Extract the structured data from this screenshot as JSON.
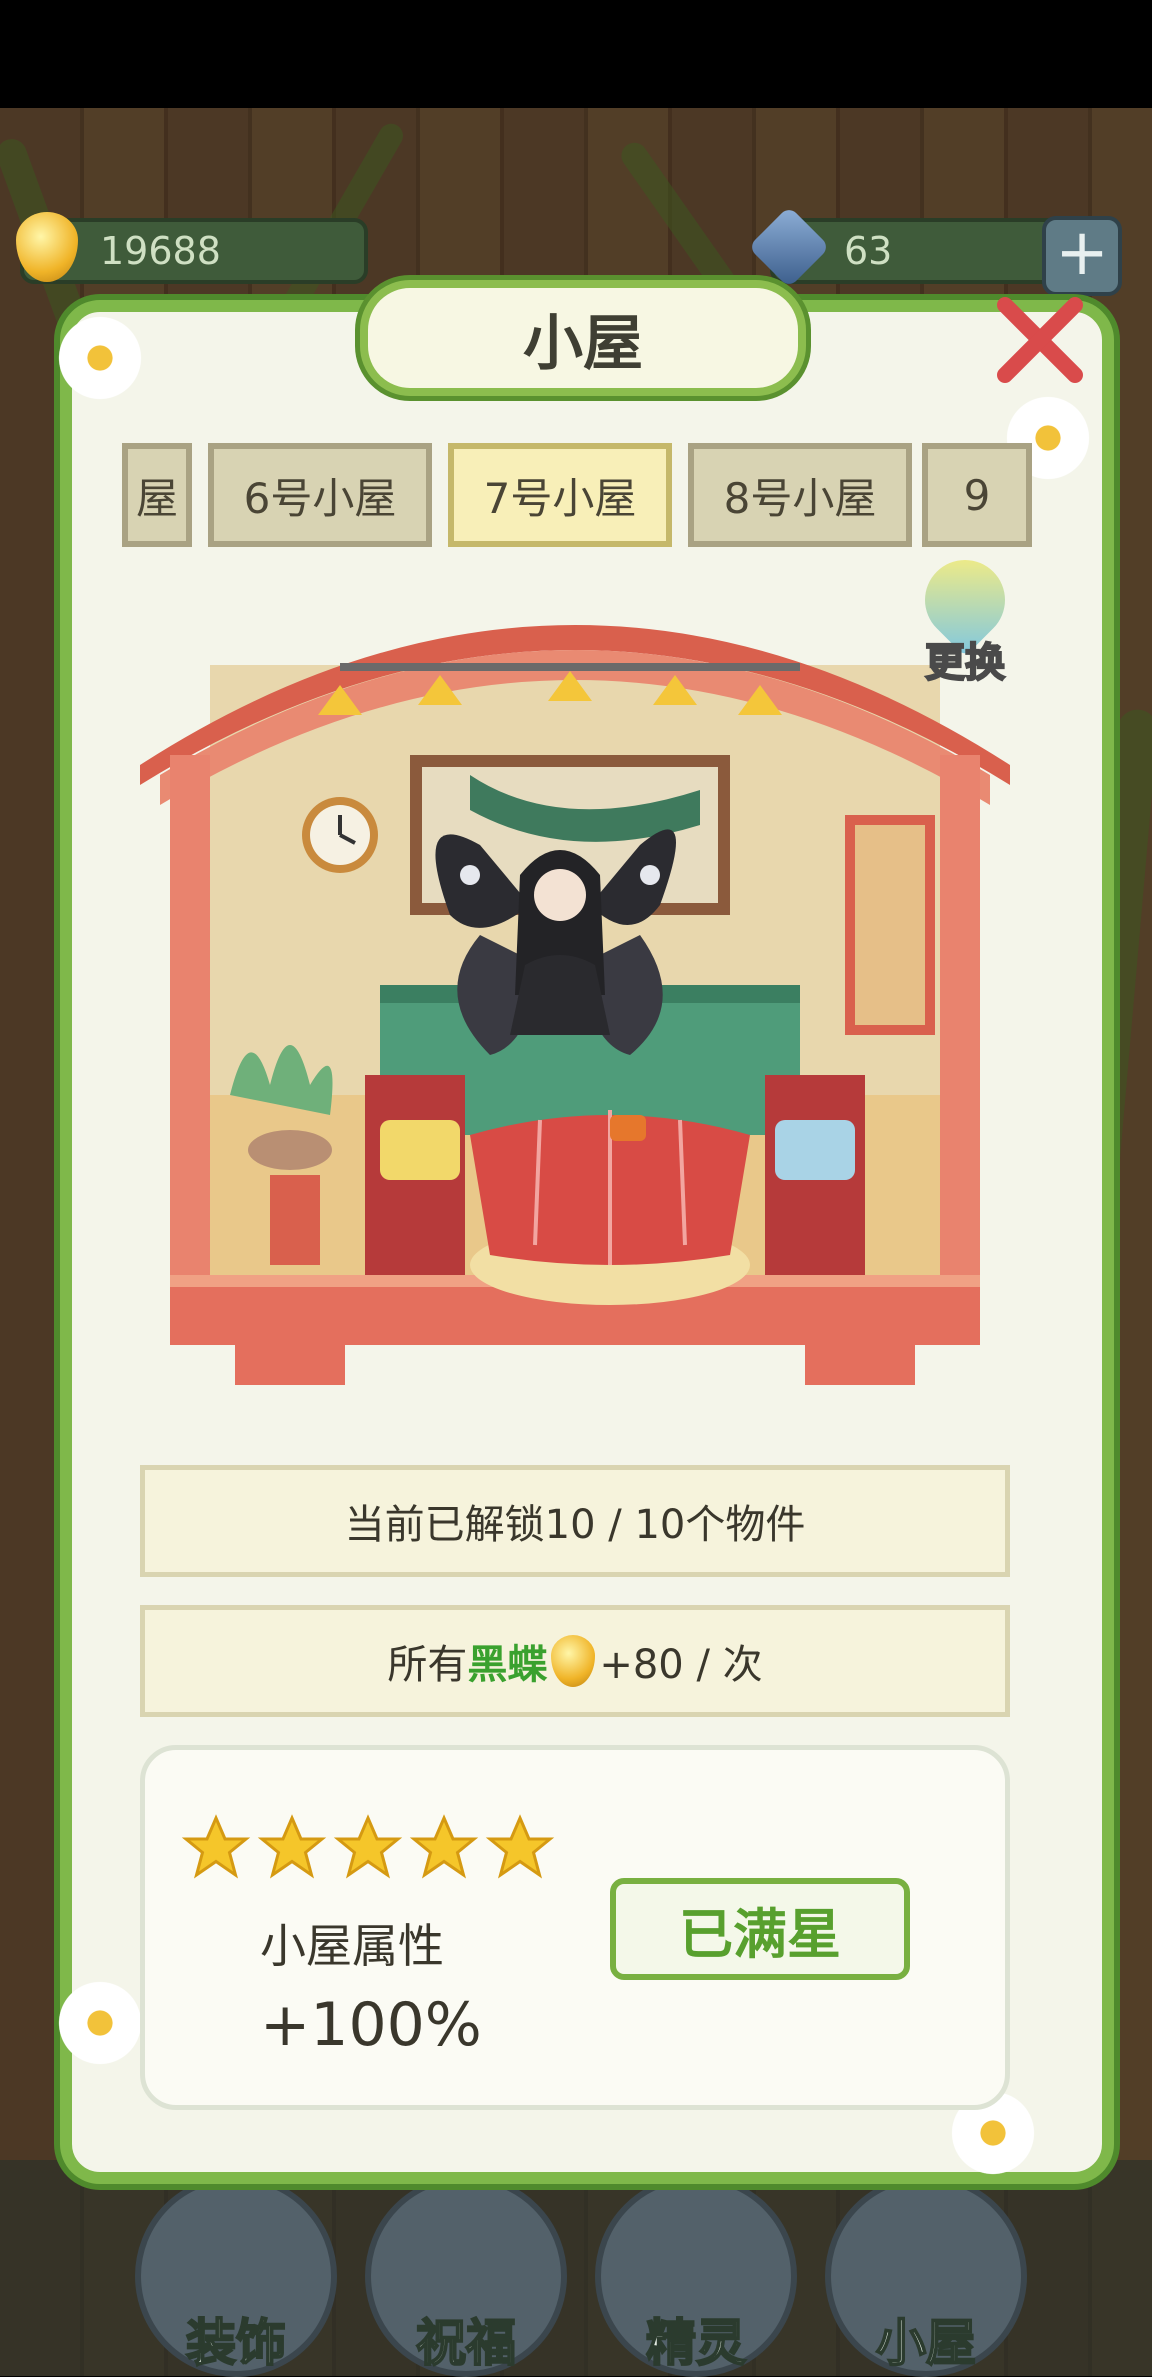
{
  "currency": {
    "gold": "19688",
    "gems": "63"
  },
  "modal": {
    "title": "小屋",
    "tabs": [
      {
        "label": "屋"
      },
      {
        "label": "6号小屋"
      },
      {
        "label": "7号小屋",
        "active": true
      },
      {
        "label": "8号小屋"
      },
      {
        "label": "9"
      }
    ],
    "change_label": "更换",
    "unlocked_text": "当前已解锁10 / 10个物件",
    "bonus": {
      "prefix": "所有",
      "highlight": "黑蝶",
      "suffix": "+80 / 次"
    },
    "stars": 5,
    "attribute_label": "小屋属性",
    "attribute_value": "+100%",
    "max_star_label": "已满星"
  },
  "bottom_nav": [
    {
      "label": "装饰"
    },
    {
      "label": "祝福"
    },
    {
      "label": "精灵"
    },
    {
      "label": "小屋"
    }
  ],
  "colors": {
    "vine_green": "#7fb84a",
    "highlight_green": "#3aa12e",
    "star_yellow": "#f5c62a"
  }
}
